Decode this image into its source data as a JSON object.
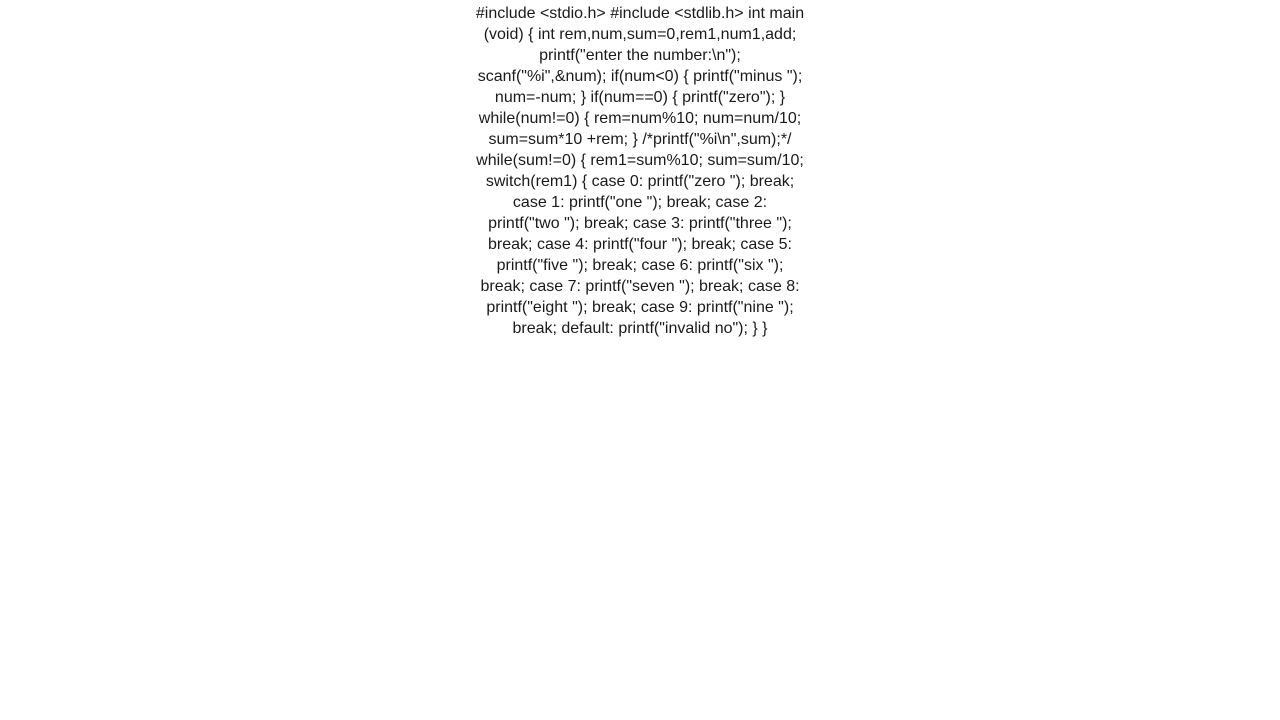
{
  "code_text": "#include <stdio.h>      #include <stdlib.h>        int main (void)      {          int rem,num,sum=0,rem1,num1,add;          printf(\"enter the number:\\n\");          scanf(\"%i\",&num);            if(num<0)          {              printf(\"minus \");              num=-num;          }          if(num==0)          {              printf(\"zero\");          }                    while(num!=0)          {              rem=num%10;              num=num/10;              sum=sum*10 +rem;          }          /*printf(\"%i\\n\",sum);*/            while(sum!=0)          {              rem1=sum%10;              sum=sum/10;                switch(rem1)              {                  case 0:                      printf(\"zero \");                      break;                  case 1:                      printf(\"one \");                      break;                  case 2:                      printf(\"two \");                      break;                  case 3:                      printf(\"three \");                      break;                  case 4:                      printf(\"four \");                      break;                  case 5:                      printf(\"five \");                      break;                  case 6:                      printf(\"six \");                      break;                  case 7:                      printf(\"seven \");                      break;                  case 8:                      printf(\"eight \");                      break;                  case 9:                      printf(\"nine \");                      break;                  default:                      printf(\"invalid no\");                }          }"
}
